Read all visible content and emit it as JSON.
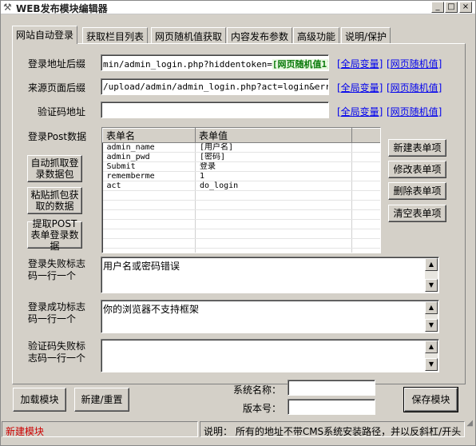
{
  "window": {
    "title": "WEB发布模块编辑器",
    "controls": {
      "minimize": "_",
      "maximize": "□",
      "close": "×"
    }
  },
  "tabs": [
    {
      "label": "网站自动登录",
      "active": true
    },
    {
      "label": "获取栏目列表"
    },
    {
      "label": "网页随机值获取"
    },
    {
      "label": "内容发布参数"
    },
    {
      "label": "高级功能"
    },
    {
      "label": "说明/保护"
    }
  ],
  "login": {
    "url_label": "登录地址后缀",
    "url_prefix": "min/admin_login.php?hiddentoken=",
    "url_token": "[网页随机值1]",
    "referer_label": "来源页面后缀",
    "referer_value": "/upload/admin/admin_login.php?act=login&err=%D3",
    "captcha_label": "验证码地址",
    "captcha_value": "",
    "link_global_var": "[全局变量]",
    "link_random_val": "[网页随机值]",
    "post_label": "登录Post数据"
  },
  "post_table": {
    "columns": [
      "表单名",
      "表单值"
    ],
    "rows": [
      [
        "admin_name",
        "[用户名]"
      ],
      [
        "admin_pwd",
        "[密码]"
      ],
      [
        "Submit",
        "登录"
      ],
      [
        "rememberme",
        "1"
      ],
      [
        "act",
        "do_login"
      ]
    ]
  },
  "left_buttons": {
    "auto_capture": "自动抓取登录数据包",
    "paste_packet": "粘贴抓包获取的数据",
    "extract_post": "提取POST表单登录数据"
  },
  "right_buttons": {
    "new_item": "新建表单项",
    "edit_item": "修改表单项",
    "delete_item": "删除表单项",
    "clear_items": "清空表单项"
  },
  "memos": {
    "fail_label": "登录失败标志码一行一个",
    "fail_value": "用户名或密码错误",
    "success_label": "登录成功标志码一行一个",
    "success_value": "你的浏览器不支持框架",
    "captcha_fail_label": "验证码失败标志码一行一个",
    "captcha_fail_value": ""
  },
  "footer": {
    "load_button": "加载模块",
    "new_reset_button": "新建/重置",
    "system_name_label": "系统名称：",
    "system_name_value": "",
    "version_label": "版本号：",
    "version_value": "",
    "save_button": "保存模块"
  },
  "status": {
    "left_text": "新建模块",
    "left_color": "#cc0000",
    "right_text": "说明：  所有的地址不带CMS系统安装路径，并以反斜杠/开头"
  },
  "icons": {
    "app": "hammer-icon",
    "scroll_up": "arrow-up-icon",
    "scroll_down": "arrow-down-icon"
  }
}
